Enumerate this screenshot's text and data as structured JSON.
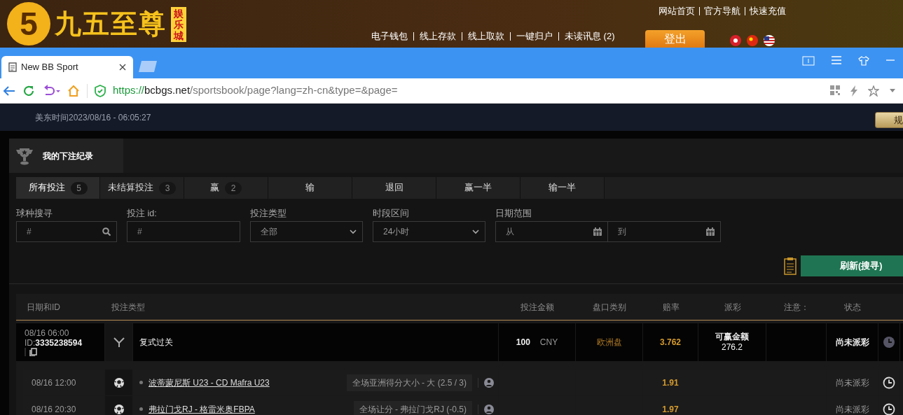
{
  "site_header": {
    "logo_digit": "5",
    "logo_text": "九五至尊",
    "logo_tag": "娱乐城",
    "top_links": [
      "网站首页",
      "官方导航",
      "快速充值"
    ],
    "nav_links": [
      "电子钱包",
      "线上存款",
      "线上取款",
      "一键归户",
      "未读讯息 (2)"
    ],
    "logout": "登出"
  },
  "browser": {
    "tab": {
      "title": "New BB Sport"
    },
    "address": {
      "scheme": "https://",
      "host": "bcbgs.net",
      "path": "/sportsbook/page?lang=zh-cn&type=&page="
    }
  },
  "time_bar": {
    "text": "美东时间2023/08/16 - 06:05:27",
    "rules_button": "规"
  },
  "panel": {
    "title": "我的下注纪录"
  },
  "filter_tabs": [
    {
      "label": "所有投注",
      "count": "5",
      "selected": true
    },
    {
      "label": "未结算投注",
      "count": "3",
      "selected": false
    },
    {
      "label": "赢",
      "count": "2",
      "selected": false
    },
    {
      "label": "输",
      "selected": false
    },
    {
      "label": "退回",
      "selected": false
    },
    {
      "label": "赢一半",
      "selected": false
    },
    {
      "label": "输一半",
      "selected": false
    }
  ],
  "filters": [
    {
      "kind": "search",
      "label": "球种搜寻",
      "placeholder": "#"
    },
    {
      "kind": "text",
      "label": "投注 id:",
      "placeholder": "#"
    },
    {
      "kind": "select",
      "label": "投注类型",
      "value": "全部"
    },
    {
      "kind": "select",
      "label": "时段区间",
      "value": "24小时"
    },
    {
      "kind": "daterange",
      "label": "日期范围",
      "from_placeholder": "从",
      "to_placeholder": "到"
    }
  ],
  "refresh_button": "刷新(搜寻)",
  "table": {
    "columns": [
      "日期和ID",
      "投注类型",
      "投注金额",
      "盘口类别",
      "赔率",
      "派彩",
      "注意：",
      "状态"
    ],
    "bet": {
      "date": "08/16 06:00",
      "id_prefix": "ID:",
      "id": "3335238594",
      "type": "复式过关",
      "amount": "100",
      "currency": "CNY",
      "market": "欧洲盘",
      "odds": "3.762",
      "payout_label": "可赢金额",
      "payout": "276.2",
      "status": "尚未派彩"
    },
    "legs": [
      {
        "date": "08/16 12:00",
        "match": "波蒂蒙尼斯 U23 - CD Mafra U23",
        "selection": "全场亚洲得分大小 - 大 (2.5 / 3)",
        "odds": "1.91",
        "status": "尚未派彩"
      },
      {
        "date": "08/16 20:30",
        "match": "弗拉门戈RJ - 格雷米奥FBPA",
        "selection": "全场让分 - 弗拉门戈RJ (-0.5)",
        "odds": "1.97",
        "status": "尚未派彩"
      }
    ]
  }
}
